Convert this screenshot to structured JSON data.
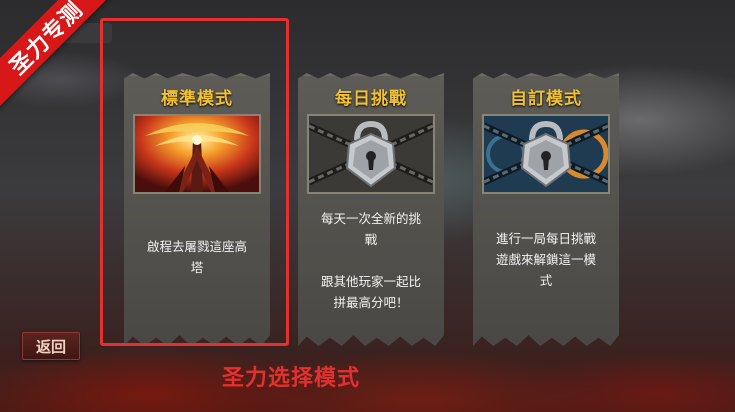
{
  "watermark": "圣力专测",
  "top_label": "",
  "cards": [
    {
      "title": "標準模式",
      "description": "啟程去屠戮這座高\n塔",
      "locked": false
    },
    {
      "title": "每日挑戰",
      "description": "每天一次全新的挑\n戰\n\n跟其他玩家一起比\n拼最高分吧！",
      "locked": true
    },
    {
      "title": "自訂模式",
      "description": "進行一局每日挑戰\n遊戲來解鎖這一模\n式",
      "locked": true
    }
  ],
  "back_label": "返回",
  "caption": "圣力选择模式",
  "colors": {
    "title_gold": "#f1c233",
    "highlight_red": "#e33030",
    "banner_red": "#d81818"
  }
}
